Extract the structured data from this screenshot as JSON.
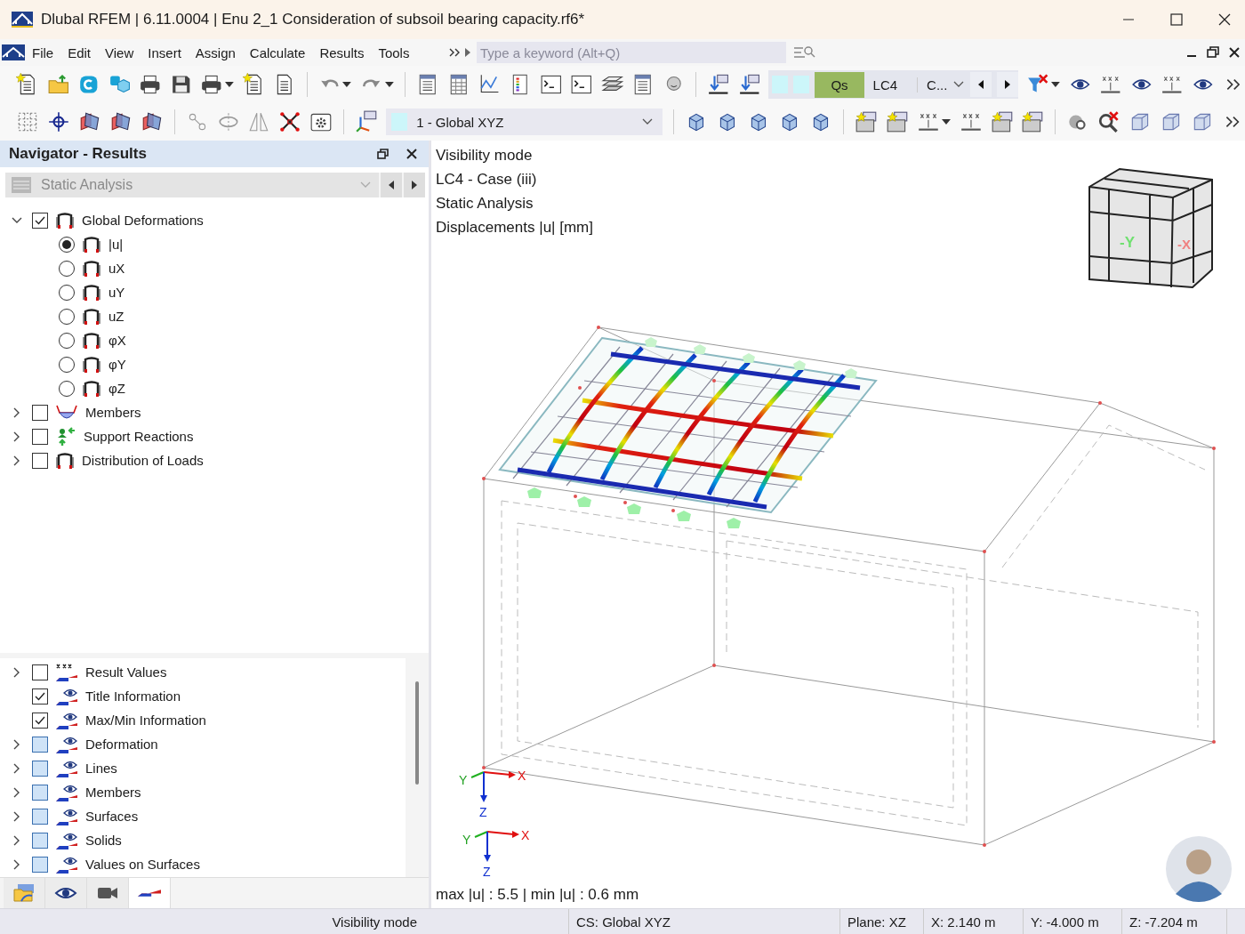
{
  "window": {
    "title": "Dlubal RFEM | 6.11.0004 | Enu 2_1 Consideration of subsoil bearing capacity.rf6*"
  },
  "menu": [
    "File",
    "Edit",
    "View",
    "Insert",
    "Assign",
    "Calculate",
    "Results",
    "Tools"
  ],
  "search": {
    "placeholder": "Type a keyword (Alt+Q)"
  },
  "toolbar": {
    "load_case": {
      "type": "Qs",
      "number": "LC4",
      "name": "C..."
    },
    "coordinate_system": "1 - Global XYZ"
  },
  "navigator": {
    "title": "Navigator - Results",
    "analysis": {
      "label": "Static Analysis",
      "disabled": true
    },
    "tree": [
      {
        "label": "Global Deformations",
        "kind": "deformation",
        "expandable": true,
        "expanded": true,
        "checked": true,
        "children": [
          {
            "label": "|u|",
            "selected": true
          },
          {
            "label": "uX",
            "selected": false
          },
          {
            "label": "uY",
            "selected": false
          },
          {
            "label": "uZ",
            "selected": false
          },
          {
            "label": "φX",
            "selected": false
          },
          {
            "label": "φY",
            "selected": false
          },
          {
            "label": "φZ",
            "selected": false
          }
        ]
      },
      {
        "label": "Members",
        "kind": "members",
        "expandable": true,
        "expanded": false,
        "checked": false
      },
      {
        "label": "Support Reactions",
        "kind": "support",
        "expandable": true,
        "expanded": false,
        "checked": false
      },
      {
        "label": "Distribution of Loads",
        "kind": "deformation",
        "expandable": true,
        "expanded": false,
        "checked": false
      }
    ],
    "display": [
      {
        "label": "Result Values",
        "kind": "values",
        "expandable": true,
        "checked": false,
        "indeterminate": false
      },
      {
        "label": "Title Information",
        "kind": "eye",
        "expandable": false,
        "checked": true,
        "indeterminate": false
      },
      {
        "label": "Max/Min Information",
        "kind": "eye",
        "expandable": false,
        "checked": true,
        "indeterminate": false
      },
      {
        "label": "Deformation",
        "kind": "eye",
        "expandable": true,
        "checked": false,
        "indeterminate": true
      },
      {
        "label": "Lines",
        "kind": "eye",
        "expandable": true,
        "checked": false,
        "indeterminate": true
      },
      {
        "label": "Members",
        "kind": "eye",
        "expandable": true,
        "checked": false,
        "indeterminate": true
      },
      {
        "label": "Surfaces",
        "kind": "eye",
        "expandable": true,
        "checked": false,
        "indeterminate": true
      },
      {
        "label": "Solids",
        "kind": "eye",
        "expandable": true,
        "checked": false,
        "indeterminate": true
      },
      {
        "label": "Values on Surfaces",
        "kind": "eye",
        "expandable": true,
        "checked": false,
        "indeterminate": true
      }
    ],
    "tabs": [
      {
        "kind": "data",
        "selected": false
      },
      {
        "kind": "display",
        "selected": false
      },
      {
        "kind": "views",
        "selected": false
      },
      {
        "kind": "results",
        "selected": true
      }
    ]
  },
  "view": {
    "info": [
      "Visibility mode",
      "LC4 - Case (iii)",
      "Static Analysis",
      "Displacements |u| [mm]"
    ],
    "view_cube": {
      "front": "-Y",
      "side": "-X"
    },
    "axes": [
      {
        "x": "X",
        "y": "Y",
        "z": "Z"
      },
      {
        "x": "X",
        "y": "Y",
        "z": "Z"
      }
    ],
    "maxmin": "max |u| : 5.5 | min |u| : 0.6 mm"
  },
  "status_bar": [
    "Visibility mode",
    "CS: Global XYZ",
    "Plane: XZ",
    "X: 2.140 m",
    "Y: -4.000 m",
    "Z: -7.204 m"
  ]
}
